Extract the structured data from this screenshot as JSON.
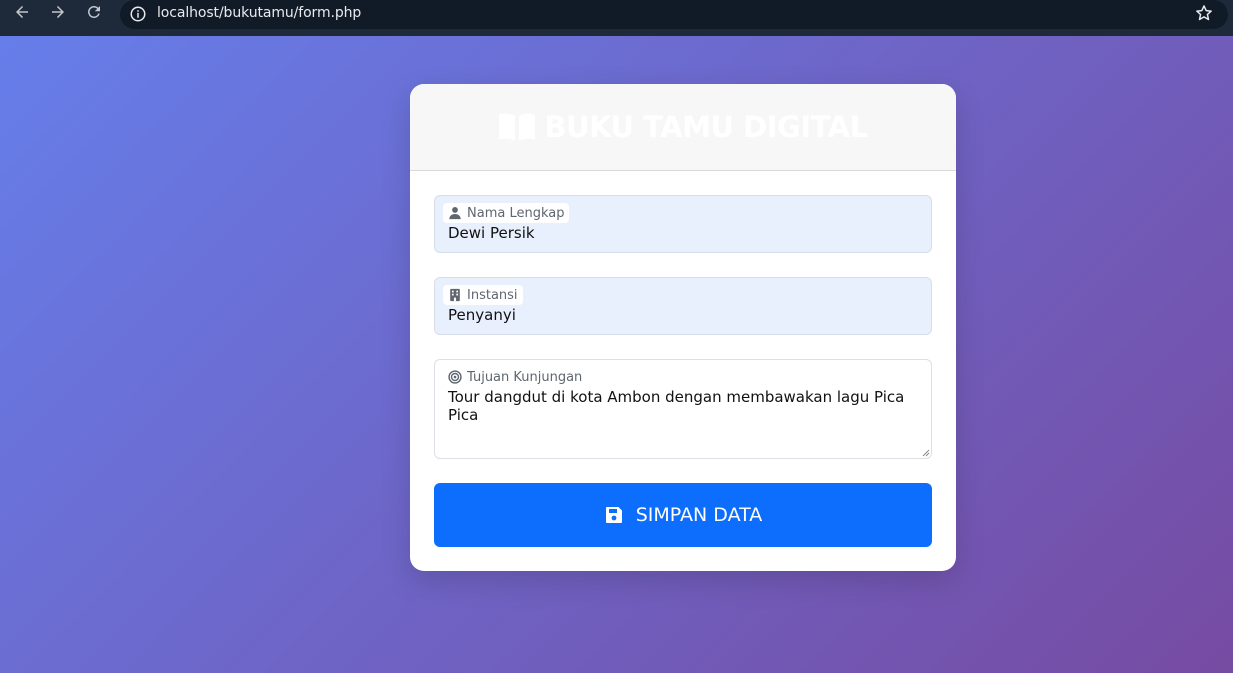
{
  "browser": {
    "url": "localhost/bukutamu/form.php"
  },
  "card": {
    "title": "BUKU TAMU DIGITAL"
  },
  "form": {
    "nama": {
      "label": "Nama Lengkap",
      "value": "Dewi Persik",
      "icon": "user-icon"
    },
    "instansi": {
      "label": "Instansi",
      "value": "Penyanyi",
      "icon": "building-icon"
    },
    "tujuan": {
      "label": "Tujuan Kunjungan",
      "value": "Tour dangdut di kota Ambon dengan membawakan lagu Pica Pica",
      "icon": "target-icon"
    },
    "submit_label": "SIMPAN DATA",
    "submit_icon": "save-icon"
  },
  "colors": {
    "gradient_start": "#667eea",
    "gradient_end": "#764ba2",
    "button": "#0d6efd",
    "autofill_bg": "#e8f0fe"
  }
}
